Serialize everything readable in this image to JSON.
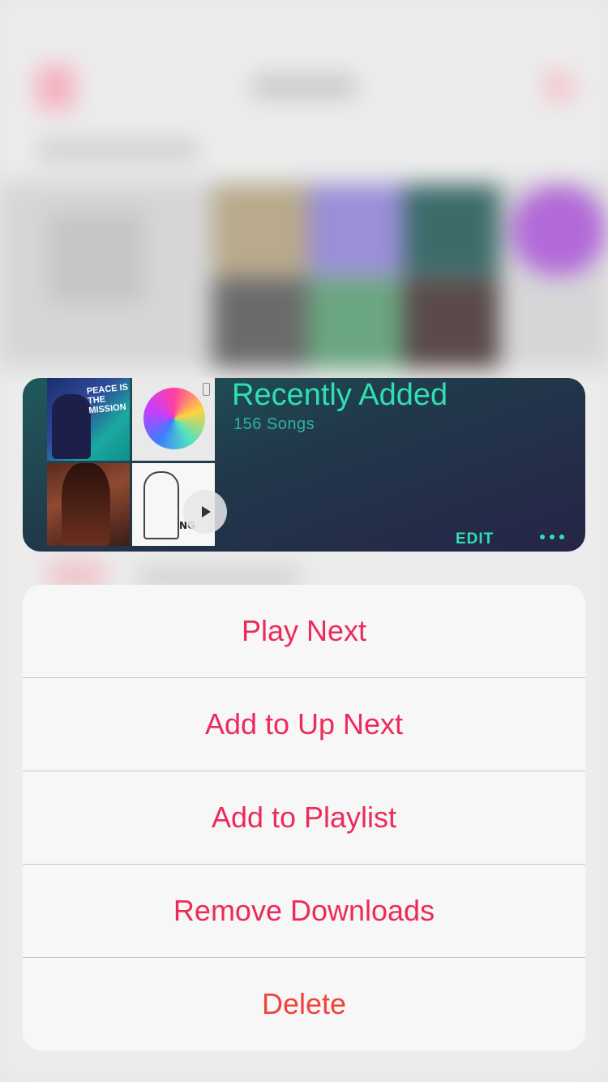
{
  "playlist_card": {
    "title": "Recently Added",
    "subtitle": "156 Songs",
    "edit_label": "EDIT",
    "accent_color": "#2ee0b1",
    "artwork": [
      {
        "icon": "album-art-peace-is-the-mission",
        "label": "PEACE IS THE MISSION"
      },
      {
        "icon": "album-art-colorful-blob",
        "label": ""
      },
      {
        "icon": "album-art-portrait",
        "label": ""
      },
      {
        "icon": "album-art-anchor-sketch",
        "label": "NG"
      }
    ]
  },
  "action_sheet": {
    "items": [
      {
        "label": "Play Next",
        "destructive": false
      },
      {
        "label": "Add to Up Next",
        "destructive": false
      },
      {
        "label": "Add to Playlist",
        "destructive": false
      },
      {
        "label": "Remove Downloads",
        "destructive": false
      },
      {
        "label": "Delete",
        "destructive": true
      }
    ],
    "action_color": "#ec2b5b",
    "destructive_color": "#f0443a"
  }
}
